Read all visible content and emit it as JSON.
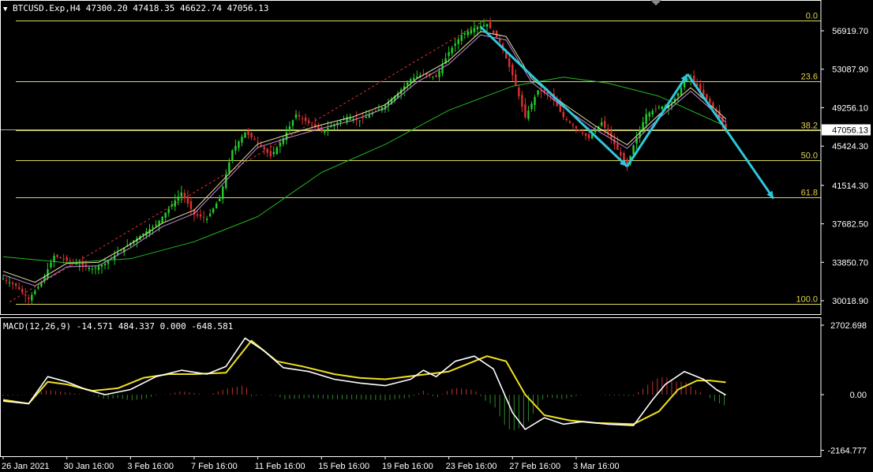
{
  "header": {
    "symbol_line": "BTCUSD.Exp,H4  47300.20 47418.35 46622.74 47056.13",
    "macd_line": "MACD(12,26,9) -14.571 484.337 0.000 -648.581"
  },
  "chart_data": [
    {
      "type": "candlestick",
      "symbol": "BTCUSD.Exp",
      "timeframe": "H4",
      "ohlc_last": {
        "open": 47300.2,
        "high": 47418.35,
        "low": 46622.74,
        "close": 47056.13
      },
      "current_price_label": "47056.13",
      "y_ticks": [
        "56919.70",
        "53087.90",
        "49256.10",
        "45424.30",
        "41514.30",
        "37682.50",
        "33850.70",
        "30018.90"
      ],
      "y_tick_values": [
        56919.7,
        53087.9,
        49256.1,
        45424.3,
        41514.3,
        37682.5,
        33850.7,
        30018.9
      ],
      "x_ticks": [
        "26 Jan 2021",
        "30 Jan 16:00",
        "3 Feb 16:00",
        "7 Feb 16:00",
        "11 Feb 16:00",
        "15 Feb 16:00",
        "19 Feb 16:00",
        "23 Feb 16:00",
        "27 Feb 16:00",
        "3 Mar 16:00"
      ],
      "fibonacci": {
        "levels": [
          {
            "label": "0.0",
            "price": 57950
          },
          {
            "label": "23.6",
            "price": 51900
          },
          {
            "label": "38.2",
            "price": 47000
          },
          {
            "label": "50.0",
            "price": 44000
          },
          {
            "label": "61.8",
            "price": 40300
          },
          {
            "label": "100.0",
            "price": 29700
          }
        ]
      },
      "price_path": [
        [
          0,
          32200
        ],
        [
          4,
          31500
        ],
        [
          8,
          30200
        ],
        [
          12,
          31800
        ],
        [
          16,
          34500
        ],
        [
          20,
          34000
        ],
        [
          24,
          33600
        ],
        [
          28,
          33200
        ],
        [
          32,
          33700
        ],
        [
          36,
          34800
        ],
        [
          40,
          35800
        ],
        [
          44,
          36700
        ],
        [
          48,
          37600
        ],
        [
          52,
          39200
        ],
        [
          56,
          40800
        ],
        [
          60,
          38600
        ],
        [
          64,
          38200
        ],
        [
          68,
          40200
        ],
        [
          72,
          45000
        ],
        [
          76,
          46800
        ],
        [
          80,
          45800
        ],
        [
          84,
          44400
        ],
        [
          88,
          46200
        ],
        [
          92,
          48600
        ],
        [
          96,
          47700
        ],
        [
          100,
          46900
        ],
        [
          104,
          47600
        ],
        [
          108,
          48300
        ],
        [
          112,
          48000
        ],
        [
          116,
          48700
        ],
        [
          120,
          49500
        ],
        [
          124,
          50700
        ],
        [
          128,
          52100
        ],
        [
          132,
          52600
        ],
        [
          136,
          52300
        ],
        [
          140,
          54800
        ],
        [
          144,
          56500
        ],
        [
          148,
          57200
        ],
        [
          152,
          57600
        ],
        [
          156,
          55800
        ],
        [
          160,
          52500
        ],
        [
          164,
          48300
        ],
        [
          168,
          51000
        ],
        [
          172,
          50500
        ],
        [
          176,
          48300
        ],
        [
          180,
          47200
        ],
        [
          184,
          46200
        ],
        [
          188,
          47800
        ],
        [
          192,
          45600
        ],
        [
          196,
          43400
        ],
        [
          198,
          45500
        ],
        [
          202,
          48600
        ],
        [
          206,
          49300
        ],
        [
          210,
          49600
        ],
        [
          214,
          51800
        ],
        [
          216,
          52300
        ],
        [
          220,
          50500
        ],
        [
          224,
          48900
        ],
        [
          227,
          47056
        ]
      ],
      "ema_short": [
        [
          0,
          32600
        ],
        [
          10,
          31500
        ],
        [
          20,
          33400
        ],
        [
          30,
          33500
        ],
        [
          40,
          35300
        ],
        [
          50,
          37400
        ],
        [
          60,
          38700
        ],
        [
          70,
          42000
        ],
        [
          80,
          45300
        ],
        [
          90,
          46300
        ],
        [
          100,
          47200
        ],
        [
          110,
          48000
        ],
        [
          120,
          49200
        ],
        [
          130,
          51800
        ],
        [
          140,
          53600
        ],
        [
          150,
          56500
        ],
        [
          158,
          56000
        ],
        [
          166,
          51800
        ],
        [
          176,
          49300
        ],
        [
          186,
          47100
        ],
        [
          196,
          45200
        ],
        [
          206,
          48200
        ],
        [
          216,
          50900
        ],
        [
          227,
          47800
        ]
      ],
      "ema_long": [
        [
          0,
          34400
        ],
        [
          20,
          33800
        ],
        [
          40,
          34200
        ],
        [
          60,
          35900
        ],
        [
          80,
          38400
        ],
        [
          100,
          42800
        ],
        [
          120,
          45600
        ],
        [
          140,
          49000
        ],
        [
          160,
          51400
        ],
        [
          176,
          52300
        ],
        [
          190,
          51700
        ],
        [
          206,
          50400
        ],
        [
          220,
          48400
        ],
        [
          227,
          47400
        ]
      ],
      "drawings": [
        {
          "from": [
            150,
            57300
          ],
          "to": [
            196,
            43400
          ]
        },
        {
          "from": [
            196,
            43400
          ],
          "to": [
            215,
            52600
          ]
        },
        {
          "from": [
            215,
            52600
          ],
          "to": [
            242,
            40200
          ]
        }
      ]
    },
    {
      "type": "macd",
      "params": "12,26,9",
      "values": {
        "macd": -14.571,
        "signal": 484.337,
        "hist": 0.0,
        "extra": -648.581
      },
      "y_ticks": [
        "2702.698",
        "0.00",
        "-2164.777"
      ],
      "y_tick_values": [
        2702.698,
        0,
        -2164.777
      ],
      "macd_line": [
        [
          0,
          -250
        ],
        [
          8,
          -350
        ],
        [
          14,
          700
        ],
        [
          20,
          500
        ],
        [
          26,
          200
        ],
        [
          32,
          0
        ],
        [
          40,
          200
        ],
        [
          48,
          700
        ],
        [
          56,
          950
        ],
        [
          64,
          800
        ],
        [
          70,
          1100
        ],
        [
          76,
          2200
        ],
        [
          82,
          1700
        ],
        [
          88,
          1050
        ],
        [
          96,
          900
        ],
        [
          104,
          600
        ],
        [
          112,
          450
        ],
        [
          120,
          350
        ],
        [
          128,
          600
        ],
        [
          132,
          950
        ],
        [
          136,
          700
        ],
        [
          142,
          1300
        ],
        [
          148,
          1500
        ],
        [
          154,
          1000
        ],
        [
          160,
          -700
        ],
        [
          164,
          -1350
        ],
        [
          170,
          -900
        ],
        [
          176,
          -1150
        ],
        [
          182,
          -1050
        ],
        [
          190,
          -1150
        ],
        [
          198,
          -1200
        ],
        [
          204,
          -200
        ],
        [
          208,
          400
        ],
        [
          214,
          900
        ],
        [
          220,
          600
        ],
        [
          224,
          200
        ],
        [
          227,
          -15
        ]
      ],
      "signal_line": [
        [
          0,
          -200
        ],
        [
          8,
          -350
        ],
        [
          14,
          500
        ],
        [
          20,
          400
        ],
        [
          28,
          150
        ],
        [
          36,
          250
        ],
        [
          44,
          650
        ],
        [
          52,
          800
        ],
        [
          60,
          800
        ],
        [
          70,
          850
        ],
        [
          78,
          2100
        ],
        [
          86,
          1300
        ],
        [
          94,
          1100
        ],
        [
          104,
          800
        ],
        [
          112,
          650
        ],
        [
          120,
          600
        ],
        [
          130,
          750
        ],
        [
          140,
          900
        ],
        [
          152,
          1500
        ],
        [
          158,
          1300
        ],
        [
          164,
          0
        ],
        [
          170,
          -800
        ],
        [
          178,
          -1000
        ],
        [
          186,
          -1100
        ],
        [
          198,
          -1150
        ],
        [
          206,
          -650
        ],
        [
          212,
          200
        ],
        [
          218,
          550
        ],
        [
          222,
          550
        ],
        [
          227,
          480
        ]
      ]
    }
  ]
}
